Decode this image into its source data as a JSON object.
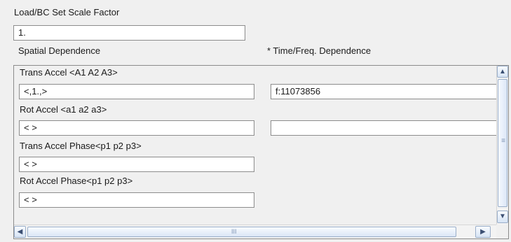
{
  "header": {
    "scale_factor_label": "Load/BC Set Scale Factor",
    "scale_factor_value": "1.",
    "spatial_label": "Spatial Dependence",
    "time_freq_label": "* Time/Freq. Dependence"
  },
  "rows": {
    "trans_accel": {
      "label": "Trans Accel <A1 A2 A3>",
      "spatial_value": "<,1.,>",
      "time_value": "f:11073856"
    },
    "rot_accel": {
      "label": "Rot Accel <a1 a2 a3>",
      "spatial_value": "<   >",
      "time_value": ""
    },
    "trans_phase": {
      "label": "Trans Accel Phase<p1 p2 p3>",
      "spatial_value": "<   >"
    },
    "rot_phase": {
      "label": "Rot Accel Phase<p1 p2 p3>",
      "spatial_value": "<   >"
    }
  },
  "scrollbars": {
    "up_arrow": "▲",
    "down_arrow": "▼",
    "left_arrow": "◀",
    "right_arrow": "▶",
    "vertical_thumb_grip": "≡",
    "horizontal_thumb_grip": "III"
  },
  "colors": {
    "window_bg": "#f0f0f0",
    "field_border": "#8c8c8c",
    "scroll_accent": "#9aaec9"
  }
}
